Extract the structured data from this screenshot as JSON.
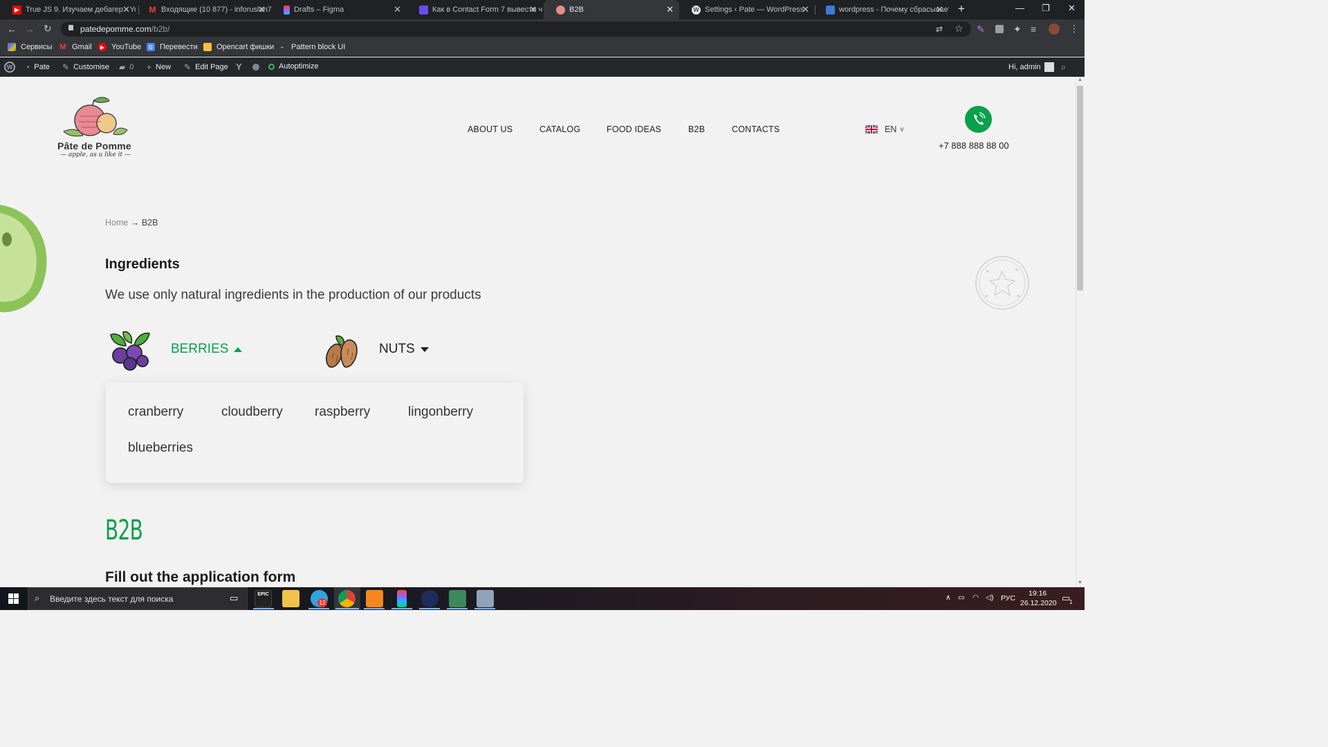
{
  "browser": {
    "tabs": [
      {
        "title": "True JS 9. Изучаем дебагер - Yo",
        "favicon_color": "#ff0000",
        "active": false
      },
      {
        "title": "Входящие (10 877) - inforuslan7",
        "favicon_color": "#ea4335",
        "favicon_glyph": "M",
        "active": false
      },
      {
        "title": "Drafts – Figma",
        "favicon_color": "#f24e1e",
        "active": false
      },
      {
        "title": "Как в Contact Form 7 вывести ч",
        "favicon_color": "#6e4cf2",
        "active": false
      },
      {
        "title": "B2B",
        "favicon_color": "#e58c8c",
        "active": true
      },
      {
        "title": "Settings ‹ Pate — WordPress",
        "favicon_color": "#464646",
        "favicon_glyph": "W",
        "active": false
      },
      {
        "title": "wordpress - Почему сбрасывает",
        "favicon_color": "#3b7bd4",
        "active": false
      }
    ],
    "url_host": "patedepomme.com",
    "url_path": "/b2b/",
    "bookmarks": [
      {
        "label": "Сервисы",
        "color": "#e8453c"
      },
      {
        "label": "Gmail",
        "color": "#ea4335",
        "glyph": "M"
      },
      {
        "label": "YouTube",
        "color": "#ff0000"
      },
      {
        "label": "Перевести",
        "color": "#4285f4"
      },
      {
        "label": "Opencart фишки",
        "color": "#f6c142"
      },
      {
        "label": "Pattern block UI",
        "color": "#9e9e9e"
      }
    ]
  },
  "wp_admin_bar": {
    "site": "Pate",
    "customise": "Customise",
    "comments": "0",
    "new": "New",
    "edit": "Edit Page",
    "autoptimize": "Autoptimize",
    "greeting": "Hi, admin"
  },
  "site": {
    "logo_title": "Pâte de Pomme",
    "logo_tagline": "apple, as u like it",
    "nav": [
      "ABOUT US",
      "CATALOG",
      "FOOD IDEAS",
      "B2B",
      "CONTACTS"
    ],
    "language": "EN",
    "phone": "+7 888 888 88 00",
    "accent_color": "#0aa14a"
  },
  "breadcrumb": {
    "home": "Home",
    "separator": "→",
    "current": "B2B"
  },
  "ingredients": {
    "heading": "Ingredients",
    "subtitle": "We use only natural ingredients in the production of our products",
    "categories": [
      {
        "label": "BERRIES",
        "expanded": true
      },
      {
        "label": "NUTS",
        "expanded": false
      }
    ],
    "berries": [
      "cranberry",
      "cloudberry",
      "raspberry",
      "lingonberry",
      "blueberries"
    ]
  },
  "b2b": {
    "heading": "B2B",
    "form_heading": "Fill out the application form"
  },
  "taskbar": {
    "search_placeholder": "Введите здесь текст для поиска",
    "telegram_badge": "12",
    "lang": "РУС",
    "time": "19:16",
    "date": "26.12.2020",
    "notifications": "1"
  }
}
